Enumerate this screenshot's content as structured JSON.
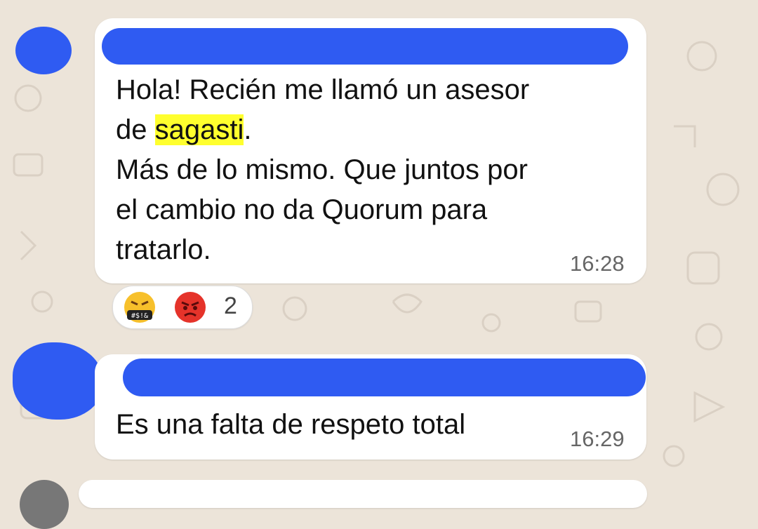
{
  "messages": [
    {
      "text_before": "Hola! Recién me llamó un asesor\nde ",
      "highlight": "sagasti",
      "text_after": ".\nMás de lo mismo. Que juntos por\nel cambio no da Quorum para\ntratarlo.",
      "time": "16:28",
      "reactions": {
        "emojis": [
          "face-with-symbols-on-mouth",
          "pouting-face"
        ],
        "count": "2"
      }
    },
    {
      "text": "Es una falta de respeto total",
      "time": "16:29"
    }
  ],
  "colors": {
    "background": "#ece4d9",
    "bubble": "#ffffff",
    "highlight": "#ffff2e",
    "redaction": "#2f5bf2"
  }
}
